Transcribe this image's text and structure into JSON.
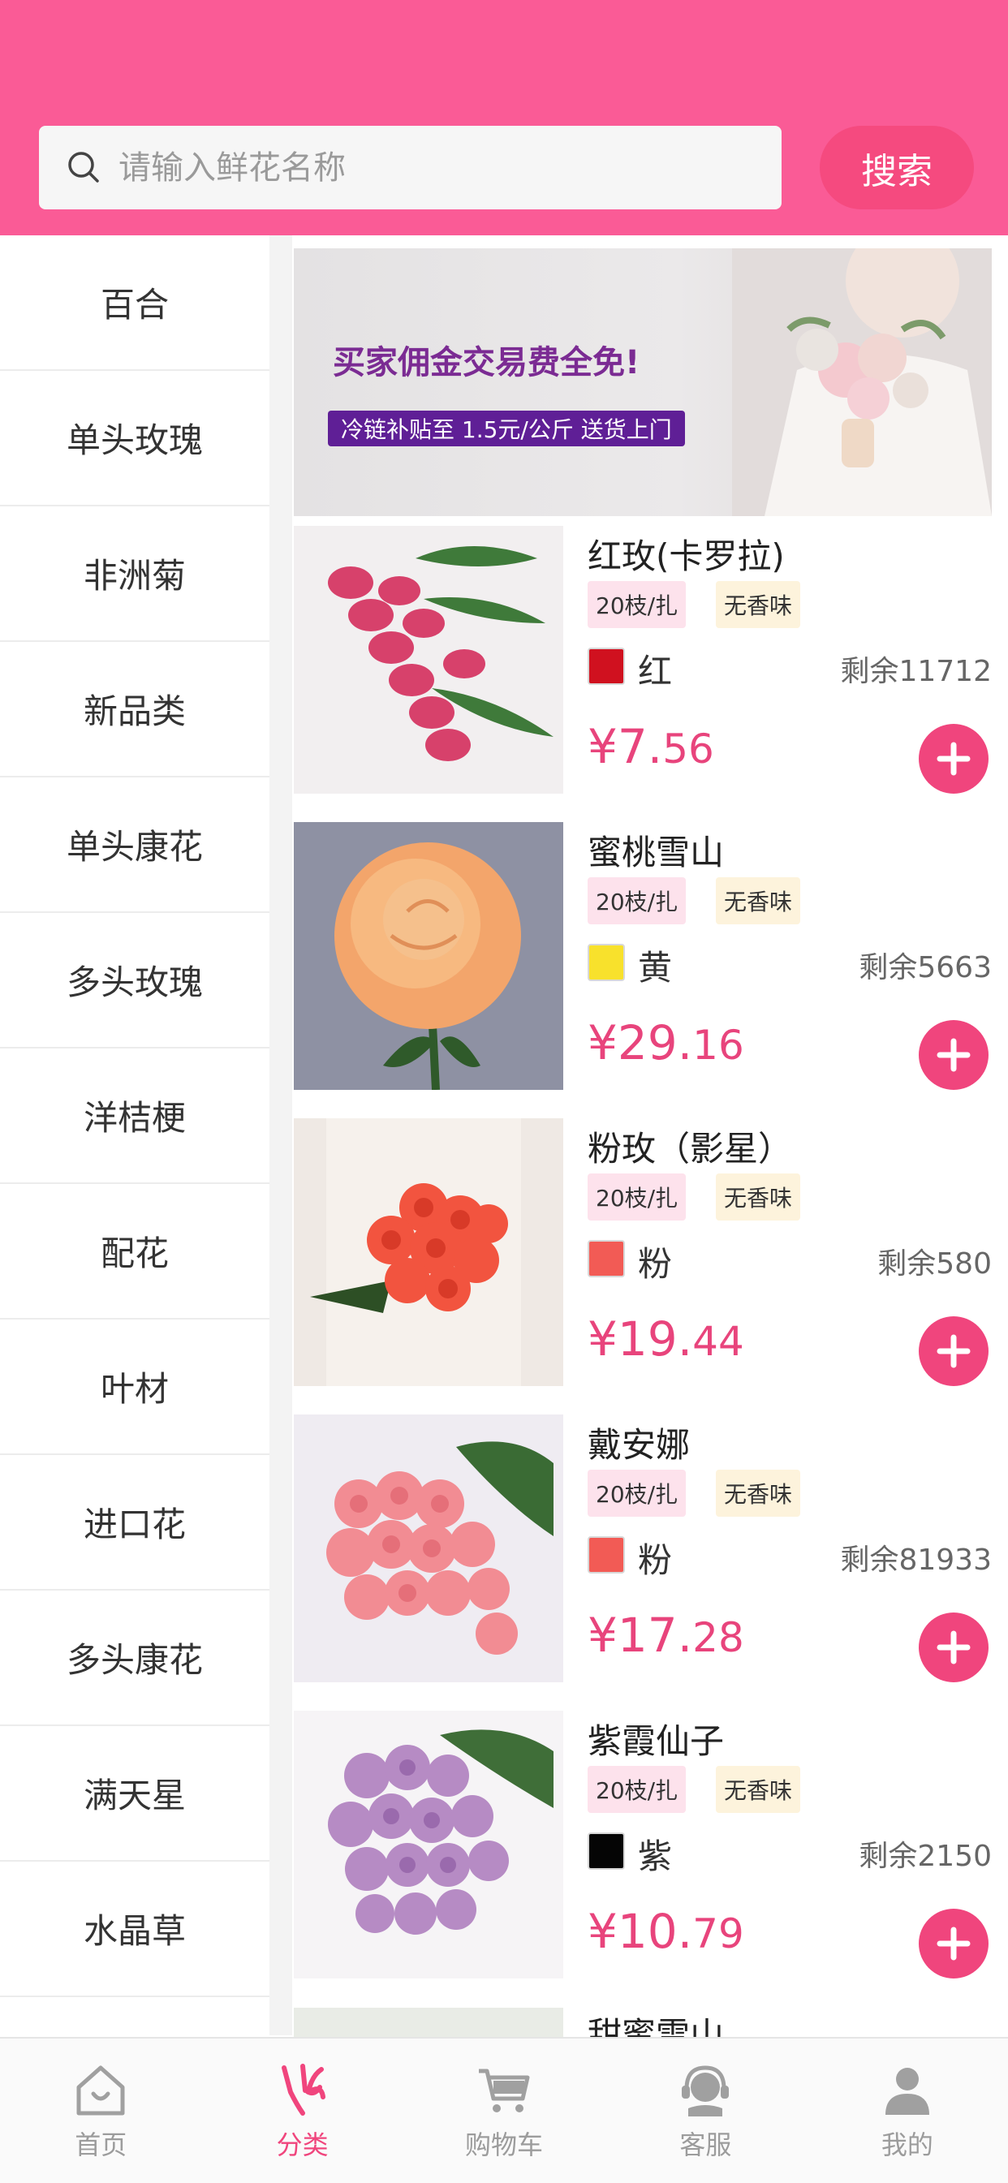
{
  "search": {
    "placeholder": "请输入鲜花名称",
    "button_label": "搜索"
  },
  "sidebar": {
    "items": [
      "百合",
      "单头玫瑰",
      "非洲菊",
      "新品类",
      "单头康花",
      "多头玫瑰",
      "洋桔梗",
      "配花",
      "叶材",
      "进口花",
      "多头康花",
      "满天星",
      "水晶草"
    ]
  },
  "banner": {
    "title": "买家佣金交易费全免!",
    "subtitle": "冷链补贴至 1.5元/公斤 送货上门"
  },
  "products": [
    {
      "name": "红玫(卡罗拉)",
      "pack": "20枝/扎",
      "scent": "无香味",
      "color_name": "红",
      "swatch": "#d0111f",
      "stock": "剩余11712",
      "price_main": "¥7.",
      "price_decimal": "56"
    },
    {
      "name": "蜜桃雪山",
      "pack": "20枝/扎",
      "scent": "无香味",
      "color_name": "黄",
      "swatch": "#f8e12c",
      "stock": "剩余5663",
      "price_main": "¥29.",
      "price_decimal": "16"
    },
    {
      "name": "粉玫（影星）",
      "pack": "20枝/扎",
      "scent": "无香味",
      "color_name": "粉",
      "swatch": "#f25b55",
      "stock": "剩余580",
      "price_main": "¥19.",
      "price_decimal": "44"
    },
    {
      "name": "戴安娜",
      "pack": "20枝/扎",
      "scent": "无香味",
      "color_name": "粉",
      "swatch": "#f25b55",
      "stock": "剩余81933",
      "price_main": "¥17.",
      "price_decimal": "28"
    },
    {
      "name": "紫霞仙子",
      "pack": "20枝/扎",
      "scent": "无香味",
      "color_name": "紫",
      "swatch": "#050505",
      "stock": "剩余2150",
      "price_main": "¥10.",
      "price_decimal": "79"
    }
  ],
  "partial_next_name": "甜蜜雪山",
  "tabbar": {
    "items": [
      "首页",
      "分类",
      "购物车",
      "客服",
      "我的"
    ],
    "active": "分类"
  },
  "colors": {
    "accent": "#fa5b96",
    "price": "#e8447c",
    "add_button": "#f0457d"
  }
}
